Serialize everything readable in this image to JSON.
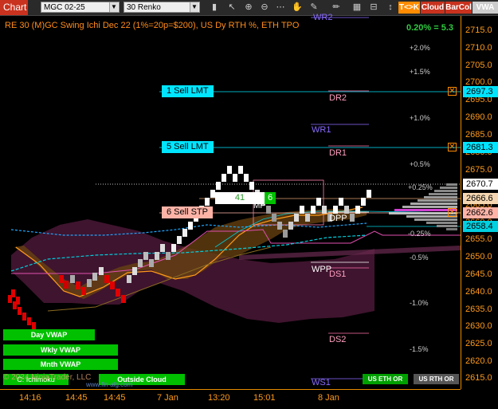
{
  "toolbar": {
    "chart_tab": "Chart",
    "symbol": "MGC 02-25",
    "bar_type": "30 Renko",
    "btn_trade": "T<>K",
    "btn_cloud": "Cloud",
    "btn_barcol": "BarCol",
    "btn_vwap": "VWA"
  },
  "chart": {
    "title": "RE 30 (M)GC Swing Ichi Dec 22 (1%=20p=$200), US Dy RTH %, ETH TPO",
    "pct_readout": "0.20% = 5.3",
    "copyright": "© 2024 NinjaTrader, LLC",
    "watermark": "www.fin-alg.com",
    "session_label": "C: Ichimoku",
    "outside_cloud": "Outside Cloud"
  },
  "axis": {
    "ticks": [
      "2715.0",
      "2710.0",
      "2705.0",
      "2700.0",
      "2695.0",
      "2690.0",
      "2685.0",
      "2680.0",
      "2675.0",
      "2670.0",
      "2665.0",
      "2660.0",
      "2655.0",
      "2650.0",
      "2645.0",
      "2640.0",
      "2635.0",
      "2630.0",
      "2625.0",
      "2620.0",
      "2615.0"
    ],
    "price_tags": {
      "sell1": "2697.3",
      "sell5": "2681.3",
      "last": "2670.7",
      "level": "2666.6",
      "sell6": "2662.6",
      "vwap": "2658.4"
    }
  },
  "orders": {
    "sell1": "1 Sell LMT",
    "sell5": "5 Sell LMT",
    "sell6": "6 Sell STP",
    "box_qty": "41",
    "box_pos": "6"
  },
  "levels": {
    "wr2": "WR2",
    "dr2": "DR2",
    "wr1": "WR1",
    "dr1": "DR1",
    "dpp": "DPP",
    "mid": "MP",
    "wpp": "WPP",
    "ds1": "DS1",
    "ds2": "DS2",
    "ws1": "WS1"
  },
  "pct_levels": [
    "+2.0%",
    "+1.5%",
    "+1.0%",
    "+0.5%",
    "+0.25%",
    "-0.25%",
    "-0.5%",
    "-1.0%",
    "-1.5%"
  ],
  "vwap_buttons": {
    "day": "Day VWAP",
    "weekly": "Wkly VWAP",
    "monthly": "Mnth VWAP"
  },
  "sessions": {
    "eth": "US ETH OR",
    "rth": "US RTH OR"
  },
  "xaxis": [
    "14:16",
    "14:45",
    "14:45",
    "7 Jan",
    "13:20",
    "15:01",
    "8 Jan"
  ],
  "colors": {
    "axis": "#ff9a1a",
    "cloud": "#5a1a40",
    "order": "#00e5ff",
    "stop": "#ffb3a7"
  }
}
